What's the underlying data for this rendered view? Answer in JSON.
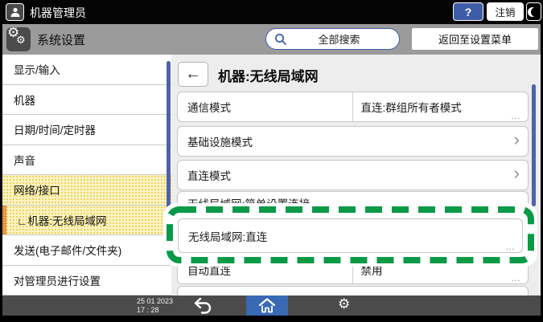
{
  "titlebar": {
    "user_label": "机器管理员",
    "help_label": "?",
    "logout_label": "注销"
  },
  "subheader": {
    "app_label": "系统设置",
    "search_label": "全部搜索",
    "return_label": "返回至设置菜单"
  },
  "sidebar": {
    "items": [
      {
        "label": "显示/输入",
        "active": false
      },
      {
        "label": "机器",
        "active": false
      },
      {
        "label": "日期/时间/定时器",
        "active": false
      },
      {
        "label": "声音",
        "active": false
      },
      {
        "label": "网络/接口",
        "active": true
      },
      {
        "label": "∟机器:无线局域网",
        "active": true,
        "selected": true
      },
      {
        "label": "发送(电子邮件/文件夹)",
        "active": false
      },
      {
        "label": "对管理员进行设置",
        "active": false
      }
    ]
  },
  "main": {
    "title": "机器:无线局域网",
    "rows": [
      {
        "label": "通信模式",
        "value": "直连:群组所有者模式"
      },
      {
        "label": "基础设施模式"
      },
      {
        "label": "直连模式"
      },
      {
        "label": "无线局域网:简单设置连接"
      },
      {
        "label": "无线局域网:直连",
        "highlighted": true
      },
      {
        "label": "自动直连",
        "value": "禁用"
      }
    ]
  },
  "navbar": {
    "date": "25 01 2023",
    "time": "17 : 28"
  },
  "ui": {
    "back_arrow": "←",
    "chevron": "›",
    "more_indicator": "…",
    "gear_glyph": "⚙"
  },
  "colors": {
    "accent_blue": "#3f5ca8",
    "scrollbar_blue": "#4d63a8",
    "home_active_blue": "#3a69b4",
    "highlight_green": "#0a9a47",
    "active_yellow": "#f5e27a",
    "selected_orange": "#e07b28",
    "navbar_gray": "#4b4b4b",
    "subheader_gray": "#9b9b9b"
  }
}
